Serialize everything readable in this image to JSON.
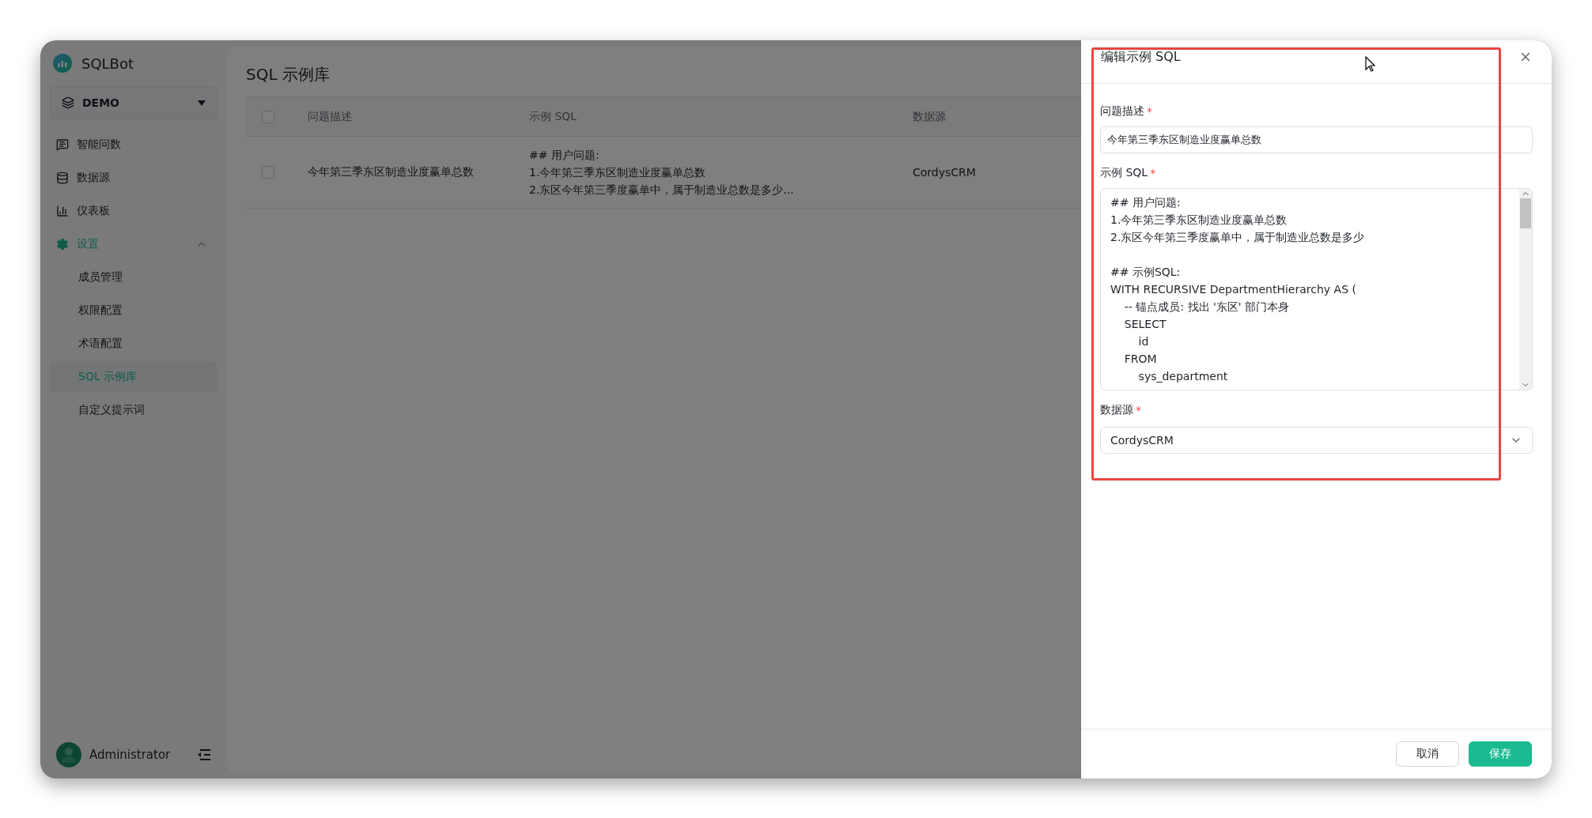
{
  "app": {
    "name": "SQLBot"
  },
  "workspace": {
    "label": "DEMO"
  },
  "nav": [
    {
      "kind": "chat",
      "label": "智能问数",
      "selected": false
    },
    {
      "kind": "database",
      "label": "数据源",
      "selected": false
    },
    {
      "kind": "chart",
      "label": "仪表板",
      "selected": false
    },
    {
      "kind": "settings",
      "label": "设置",
      "selected": true,
      "expanded": true,
      "children": [
        {
          "label": "成员管理",
          "selected": false
        },
        {
          "label": "权限配置",
          "selected": false
        },
        {
          "label": "术语配置",
          "selected": false
        },
        {
          "label": "SQL 示例库",
          "selected": true
        },
        {
          "label": "自定义提示词",
          "selected": false
        }
      ]
    }
  ],
  "user": {
    "name": "Administrator"
  },
  "page": {
    "title": "SQL 示例库",
    "table": {
      "all_selected": false,
      "columns": [
        "问题描述",
        "示例 SQL",
        "数据源"
      ],
      "rows": [
        {
          "selected": false,
          "question": "今年第三季东区制造业度赢单总数",
          "sql_lines": [
            "## 用户问题:",
            "1.今年第三季东区制造业度赢单总数",
            "2.东区今年第三季度赢单中，属于制造业总数是多少..."
          ],
          "datasource": "CordysCRM"
        }
      ]
    }
  },
  "drawer": {
    "title": "编辑示例 SQL",
    "fields": [
      {
        "kind": "input",
        "label": "问题描述",
        "required_mark": "*",
        "value": "今年第三季东区制造业度赢单总数"
      },
      {
        "kind": "code",
        "label": "示例 SQL",
        "required_mark": "*",
        "blocks": [
          [
            "## 用户问题:",
            "1.今年第三季东区制造业度赢单总数",
            "2.东区今年第三季度赢单中，属于制造业总数是多少"
          ],
          [
            "## 示例SQL:",
            "WITH RECURSIVE DepartmentHierarchy AS (",
            "    -- 锚点成员: 找出 '东区' 部门本身",
            "    SELECT",
            "        id",
            "    FROM",
            "        sys_department"
          ]
        ]
      },
      {
        "kind": "select",
        "label": "数据源",
        "required_mark": "*",
        "value": "CordysCRM"
      }
    ],
    "buttons": [
      {
        "label": "取消",
        "primary": false
      },
      {
        "label": "保存",
        "primary": true
      }
    ]
  }
}
